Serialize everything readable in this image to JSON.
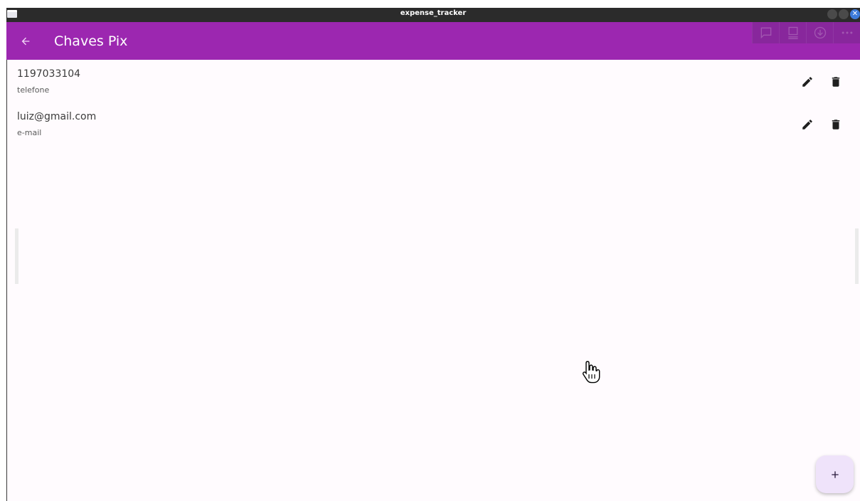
{
  "window": {
    "title": "expense_tracker"
  },
  "appbar": {
    "title": "Chaves Pix",
    "back_icon": "arrow-back-icon",
    "background": "#9c27b0"
  },
  "keys": [
    {
      "value": "1197033104",
      "type": "telefone"
    },
    {
      "value": "luiz@gmail.com",
      "type": "e-mail"
    }
  ],
  "icons": {
    "edit": "pencil-icon",
    "delete": "trash-icon",
    "add": "plus-icon"
  },
  "colors": {
    "accent": "#9c27b0",
    "surface": "#fffbfe",
    "fab": "#efe3fa"
  }
}
